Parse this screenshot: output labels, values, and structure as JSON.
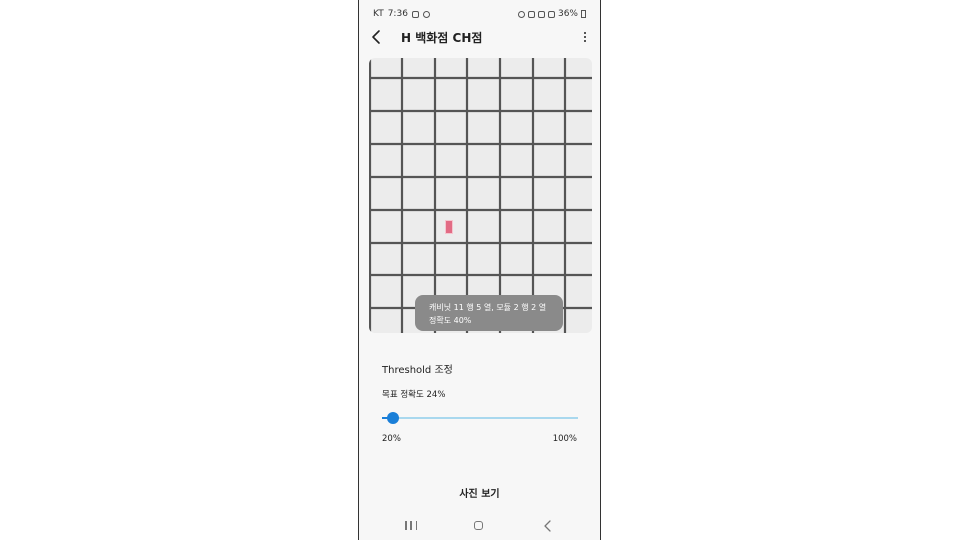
{
  "status_bar": {
    "carrier": "KT",
    "time": "7:36",
    "battery": "36%"
  },
  "app_bar": {
    "title": "H 백화점 CH점",
    "back_icon": "back-arrow-icon",
    "menu_icon": "more-vert-icon"
  },
  "grid": {
    "columns": 7,
    "rows": 8,
    "marker_color": "#e26b84",
    "background": "#ececec",
    "line_color": "#555555"
  },
  "detection_toast": {
    "line1": "캐비닛 11 행 5 열, 모듈 2 행 2 열",
    "line2": "정확도 40%"
  },
  "threshold": {
    "title": "Threshold 조정",
    "target_label": "목표 정확도 24%",
    "value": 24,
    "min_label": "20%",
    "max_label": "100%",
    "accent_color": "#1a7fd8"
  },
  "actions": {
    "view_photo": "사진 보기"
  },
  "nav_bar": {
    "recents_icon": "recents-icon",
    "home_icon": "home-icon",
    "back_icon": "nav-back-icon"
  }
}
